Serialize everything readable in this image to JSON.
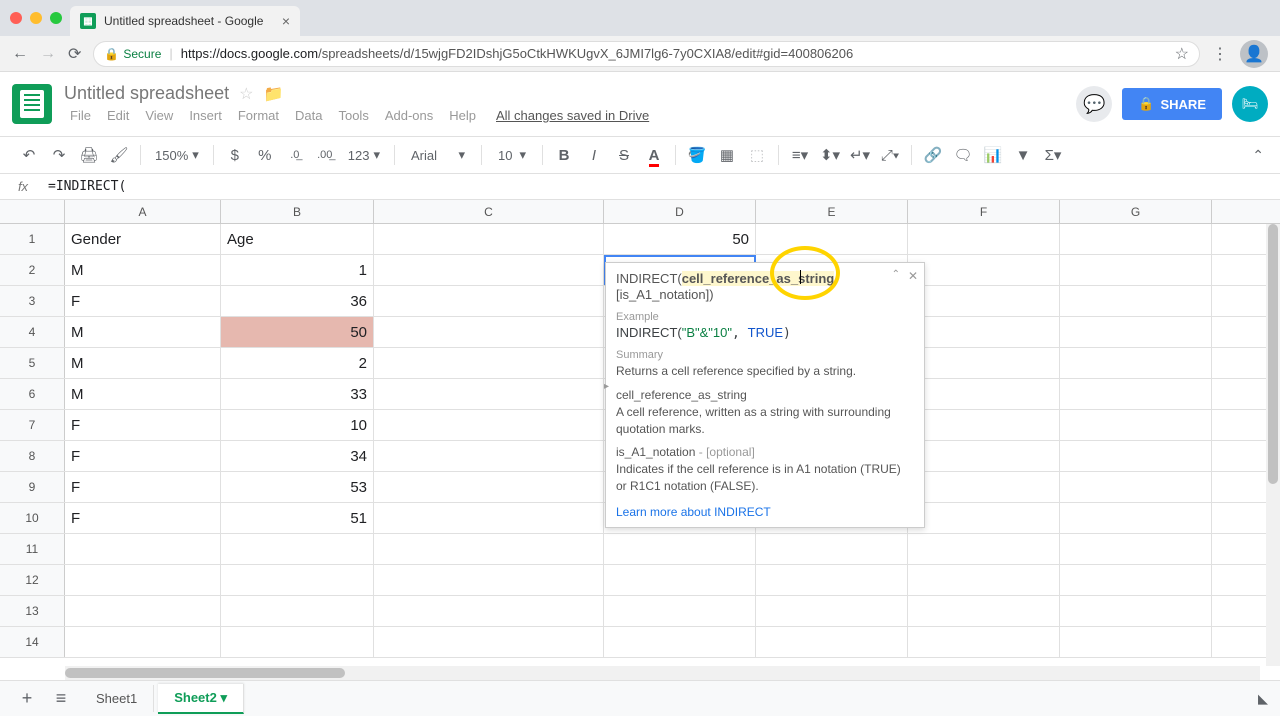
{
  "browser": {
    "tab_title": "Untitled spreadsheet - Google",
    "url_prefix": "Secure",
    "url_host": "https://docs.google.com",
    "url_path": "/spreadsheets/d/15wjgFD2IDshjG5oCtkHWKUgvX_6JMI7lg6-7y0CXIA8/edit#gid=400806206"
  },
  "doc": {
    "title": "Untitled spreadsheet",
    "save_status": "All changes saved in Drive",
    "share_label": "SHARE"
  },
  "menu": [
    "File",
    "Edit",
    "View",
    "Insert",
    "Format",
    "Data",
    "Tools",
    "Add-ons",
    "Help"
  ],
  "toolbar": {
    "zoom": "150%",
    "currency": "$",
    "percent": "%",
    "dec_dec": ".0",
    "dec_inc": ".00",
    "num_fmt": "123",
    "font": "Arial",
    "font_size": "10"
  },
  "formula_bar": {
    "fx": "fx",
    "value": "=INDIRECT("
  },
  "columns": [
    "A",
    "B",
    "C",
    "D",
    "E",
    "F",
    "G"
  ],
  "rows": [
    {
      "n": "1",
      "A": "Gender",
      "B": "Age",
      "D": "50"
    },
    {
      "n": "2",
      "A": "M",
      "B": "1",
      "D": "=INDIRECT("
    },
    {
      "n": "3",
      "A": "F",
      "B": "36"
    },
    {
      "n": "4",
      "A": "M",
      "B": "50"
    },
    {
      "n": "5",
      "A": "M",
      "B": "2"
    },
    {
      "n": "6",
      "A": "M",
      "B": "33"
    },
    {
      "n": "7",
      "A": "F",
      "B": "10"
    },
    {
      "n": "8",
      "A": "F",
      "B": "34"
    },
    {
      "n": "9",
      "A": "F",
      "B": "53"
    },
    {
      "n": "10",
      "A": "F",
      "B": "51"
    },
    {
      "n": "11"
    },
    {
      "n": "12"
    },
    {
      "n": "13"
    },
    {
      "n": "14"
    }
  ],
  "help": {
    "sig_fn": "INDIRECT(",
    "sig_arg1": "cell_reference_as_string",
    "sig_rest": ", [is_A1_notation])",
    "example_label": "Example",
    "example_fn": "INDIRECT(",
    "example_str": "\"B\"&\"10\"",
    "example_lit": "TRUE",
    "summary_label": "Summary",
    "summary_text": "Returns a cell reference specified by a string.",
    "arg1_name": "cell_reference_as_string",
    "arg1_desc": "A cell reference, written as a string with surrounding quotation marks.",
    "arg2_name": "is_A1_notation",
    "arg2_opt": " - [optional]",
    "arg2_desc": "Indicates if the cell reference is in A1 notation (TRUE) or R1C1 notation (FALSE).",
    "link": "Learn more about INDIRECT"
  },
  "sheets": {
    "tab1": "Sheet1",
    "tab2": "Sheet2"
  }
}
